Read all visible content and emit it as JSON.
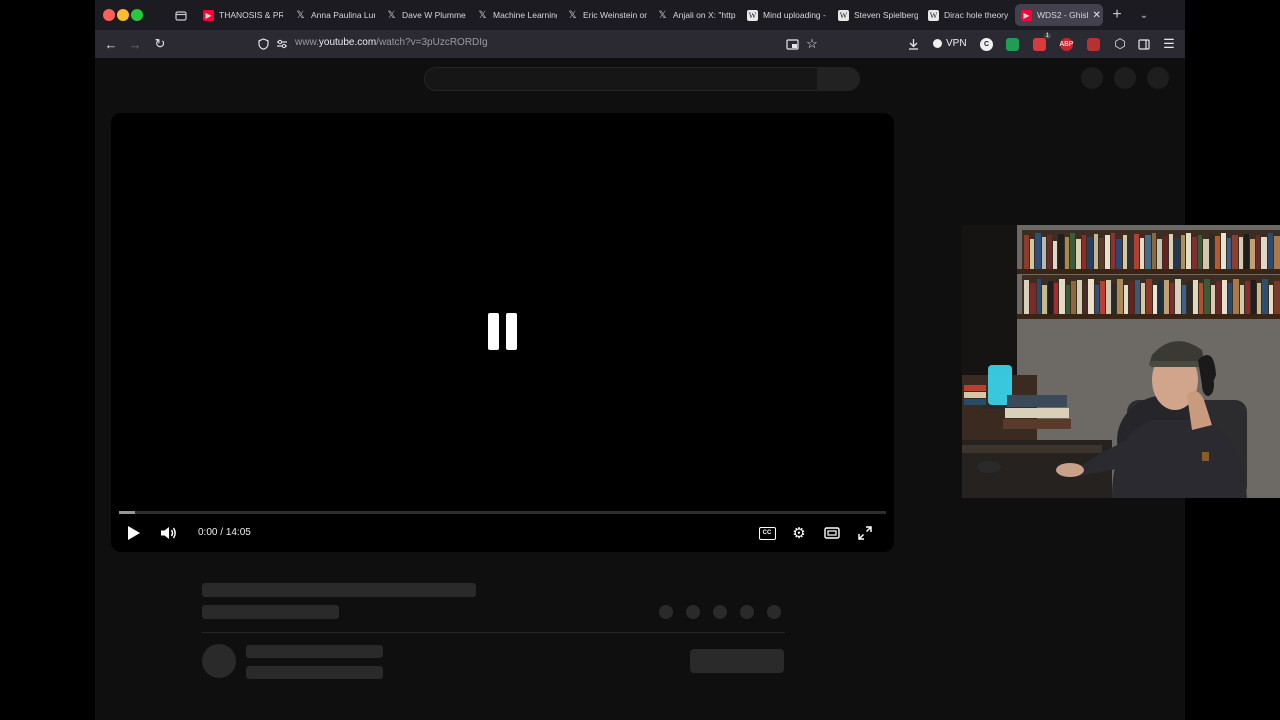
{
  "browser": {
    "tabs": [
      {
        "title": "THANOSIS & PR",
        "icon": "youtube-icon"
      },
      {
        "title": "Anna Paulina Lun",
        "icon": "x-icon"
      },
      {
        "title": "Dave W Plummer",
        "icon": "x-icon"
      },
      {
        "title": "Machine Learning",
        "icon": "x-icon"
      },
      {
        "title": "Eric Weinstein on",
        "icon": "x-icon"
      },
      {
        "title": "Anjali on X: \"http",
        "icon": "x-icon"
      },
      {
        "title": "Mind uploading -",
        "icon": "wikipedia-icon"
      },
      {
        "title": "Steven Spielberg",
        "icon": "wikipedia-icon"
      },
      {
        "title": "Dirac hole theory",
        "icon": "wikipedia-icon"
      },
      {
        "title": "WDS2 - Ghisl",
        "icon": "youtube-icon",
        "active": true
      }
    ],
    "url_prefix": "www.",
    "url_domain": "youtube.com",
    "url_path": "/watch?v=3pUzcRORDIg",
    "vpn_label": "VPN",
    "notification_count": "1"
  },
  "player": {
    "current_time": "0:00",
    "duration": "14:05",
    "time_separator": " / ",
    "cc_label": "CC",
    "progress_fraction": 0.0
  },
  "colors": {
    "youtube_red": "#ff0033",
    "browser_chrome": "#2b2a33",
    "page_background": "#0f0f0f",
    "skeleton": "#2a2a2a"
  }
}
